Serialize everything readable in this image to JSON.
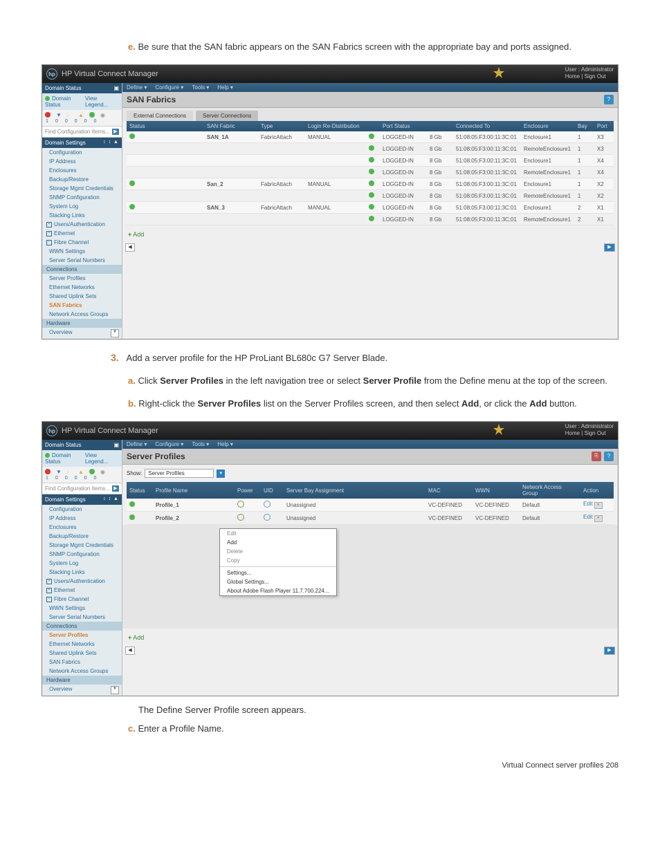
{
  "doc": {
    "step_e_label": "e.",
    "step_e_text": "Be sure that the SAN fabric appears on the SAN Fabrics screen with the appropriate bay and ports assigned.",
    "step_3_label": "3.",
    "step_3_text": "Add a server profile for the HP ProLiant BL680c G7 Server Blade.",
    "step_a_label": "a.",
    "step_a_text_1": "Click ",
    "step_a_bold_1": "Server Profiles",
    "step_a_text_2": " in the left navigation tree or select ",
    "step_a_bold_2": "Server Profile",
    "step_a_text_3": " from the Define menu at the top of the screen.",
    "step_b_label": "b.",
    "step_b_text_1": "Right-click the ",
    "step_b_bold_1": "Server Profiles",
    "step_b_text_2": " list on the Server Profiles screen, and then select ",
    "step_b_bold_2": "Add",
    "step_b_text_3": ", or click the ",
    "step_b_bold_3": "Add",
    "step_b_text_4": " button.",
    "after_b": "The Define Server Profile screen appears.",
    "step_c_label": "c.",
    "step_c_text": "Enter a Profile Name.",
    "footer": "Virtual Connect server profiles   208"
  },
  "app": {
    "title": "HP Virtual Connect Manager",
    "user_line1": "User : Administrator",
    "user_line2": "Home | Sign Out",
    "menu": [
      "Define ▾",
      "Configure ▾",
      "Tools ▾",
      "Help ▾"
    ]
  },
  "sidebar": {
    "domain_status_label": "Domain Status",
    "domain_status_link": "Domain Status",
    "view_legend_link": "View Legend...",
    "counts": [
      "1",
      "0",
      "0",
      "0",
      "0",
      "0"
    ],
    "search_placeholder": "Find Configuration Items...",
    "sections": {
      "domain_settings": "Domain Settings",
      "items_domain": [
        "Configuration",
        "IP Address",
        "Enclosures",
        "Backup/Restore",
        "Storage Mgmt Credentials",
        "SNMP Configuration",
        "System Log",
        "Stacking Links"
      ],
      "users": "Users/Authentication",
      "ethernet": "Ethernet",
      "fibre": "Fibre Channel",
      "fibre_items": [
        "WWN Settings",
        "Server Serial Numbers"
      ],
      "connections": "Connections",
      "connections_items": [
        "Server Profiles",
        "Ethernet Networks",
        "Shared Uplink Sets",
        "SAN Fabrics",
        "Network Access Groups"
      ],
      "hardware": "Hardware",
      "hardware_items": [
        "Overview"
      ]
    }
  },
  "screen1": {
    "title": "SAN Fabrics",
    "tabs": [
      "External Connections",
      "Server Connections"
    ],
    "active_tab": 0,
    "headers": [
      "Status",
      "SAN Fabric",
      "Type",
      "Login Re-Distribution",
      "",
      "Port Status",
      "",
      "Connected To",
      "Enclosure",
      "Bay",
      "Port"
    ],
    "rows": [
      {
        "status": "ok",
        "fabric": "SAN_1A",
        "type": "FabricAttach",
        "login": "MANUAL",
        "port_status": "LOGGED-IN",
        "speed": "8 Gb",
        "conn": "51:08:05:F3:00:11:3C:01",
        "enc": "Enclosure1",
        "bay": "1",
        "port": "X3"
      },
      {
        "status": "",
        "fabric": "",
        "type": "",
        "login": "",
        "port_status": "LOGGED-IN",
        "speed": "8 Gb",
        "conn": "51:08:05:F3:00:11:3C:01",
        "enc": "RemoteEnclosure1",
        "bay": "1",
        "port": "X3"
      },
      {
        "status": "",
        "fabric": "",
        "type": "",
        "login": "",
        "port_status": "LOGGED-IN",
        "speed": "8 Gb",
        "conn": "51:08:05:F3:00:11:3C:01",
        "enc": "Enclosure1",
        "bay": "1",
        "port": "X4"
      },
      {
        "status": "",
        "fabric": "",
        "type": "",
        "login": "",
        "port_status": "LOGGED-IN",
        "speed": "8 Gb",
        "conn": "51:08:05:F3:00:11:3C:01",
        "enc": "RemoteEnclosure1",
        "bay": "1",
        "port": "X4"
      },
      {
        "status": "ok",
        "fabric": "San_2",
        "type": "FabricAttach",
        "login": "MANUAL",
        "port_status": "LOGGED-IN",
        "speed": "8 Gb",
        "conn": "51:08:05:F3:00:11:3C:01",
        "enc": "Enclosure1",
        "bay": "1",
        "port": "X2"
      },
      {
        "status": "",
        "fabric": "",
        "type": "",
        "login": "",
        "port_status": "LOGGED-IN",
        "speed": "8 Gb",
        "conn": "51:08:05:F3:00:11:3C:01",
        "enc": "RemoteEnclosure1",
        "bay": "1",
        "port": "X2"
      },
      {
        "status": "ok",
        "fabric": "SAN_3",
        "type": "FabricAttach",
        "login": "MANUAL",
        "port_status": "LOGGED-IN",
        "speed": "8 Gb",
        "conn": "51:08:05:F3:00:11:3C:01",
        "enc": "Enclosure1",
        "bay": "2",
        "port": "X1"
      },
      {
        "status": "",
        "fabric": "",
        "type": "",
        "login": "",
        "port_status": "LOGGED-IN",
        "speed": "8 Gb",
        "conn": "51:08:05:F3:00:11:3C:01",
        "enc": "RemoteEnclosure1",
        "bay": "2",
        "port": "X1"
      }
    ],
    "add": "Add",
    "active_nav": "SAN Fabrics"
  },
  "screen2": {
    "title": "Server Profiles",
    "show_label": "Show:",
    "show_value": "Server Profiles",
    "headers": [
      "Status",
      "Profile Name",
      "Power",
      "UID",
      "Server Bay Assignment",
      "MAC",
      "WWN",
      "Network Access Group",
      "Action"
    ],
    "rows": [
      {
        "status": "ok",
        "name": "Profile_1",
        "power": "off",
        "uid": "off",
        "assign": "Unassigned",
        "mac": "VC-DEFINED",
        "wwn": "VC-DEFINED",
        "nag": "Default",
        "action": "Edit"
      },
      {
        "status": "ok",
        "name": "Profile_2",
        "power": "off",
        "uid": "off",
        "assign": "Unassigned",
        "mac": "VC-DEFINED",
        "wwn": "VC-DEFINED",
        "nag": "Default",
        "action": "Edit"
      }
    ],
    "context_menu": [
      "Edit",
      "Add",
      "Delete",
      "Copy",
      "Settings...",
      "Global Settings...",
      "About Adobe Flash Player 11.7.700.224..."
    ],
    "add": "Add",
    "active_nav": "Server Profiles"
  }
}
